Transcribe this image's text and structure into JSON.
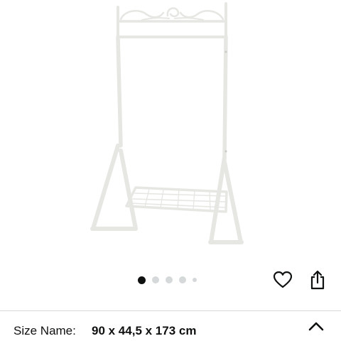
{
  "product": {
    "image_alt": "Clothes rack",
    "image_count": 5,
    "active_image": 1
  },
  "actions": {
    "favorite_icon": "heart-icon",
    "share_icon": "share-icon"
  },
  "variation": {
    "label": "Size Name:",
    "value": "90 x 44,5 x 173 cm",
    "expand_icon": "chevron-up-icon"
  },
  "colors": {
    "active_dot": "#0f1111",
    "inactive_dot": "#d5d9d9",
    "text": "#0f1111",
    "divider": "#d5d9d9"
  }
}
